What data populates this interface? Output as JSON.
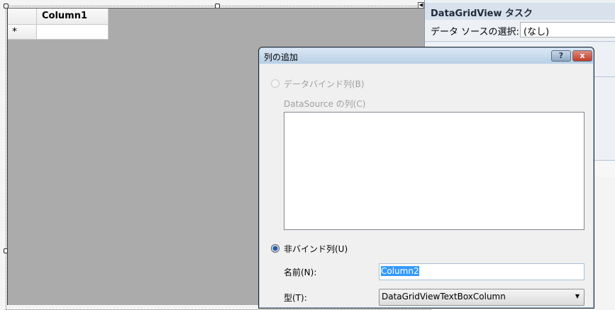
{
  "grid": {
    "column_header": "Column1",
    "new_row_marker": "*"
  },
  "tasks_panel": {
    "title": "DataGridView タスク",
    "datasource_label": "データ ソースの選択:",
    "datasource_value": "(なし)"
  },
  "dialog": {
    "title": "列の追加",
    "help_button": "?",
    "close_button": "x",
    "bound_radio_label": "データバインド列(B)",
    "datasource_columns_label": "DataSource の列(C)",
    "unbound_radio_label": "非バインド列(U)",
    "name_label": "名前(N):",
    "name_value": "Column2",
    "type_label": "型(T):",
    "type_value": "DataGridViewTextBoxColumn"
  }
}
